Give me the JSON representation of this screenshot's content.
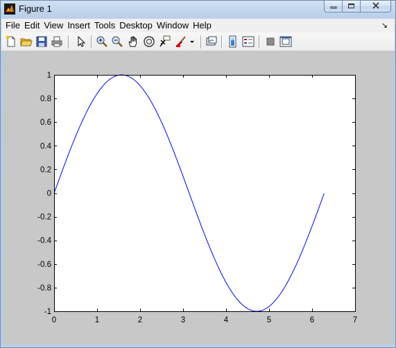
{
  "window": {
    "title": "Figure 1"
  },
  "menu": {
    "items": [
      "File",
      "Edit",
      "View",
      "Insert",
      "Tools",
      "Desktop",
      "Window",
      "Help"
    ],
    "overflow_arrow": "↘"
  },
  "toolbar": {
    "icons": [
      "new-figure-icon",
      "open-file-icon",
      "save-figure-icon",
      "print-figure-icon",
      "edit-plot-arrow-icon",
      "zoom-in-icon",
      "zoom-out-icon",
      "pan-hand-icon",
      "rotate-3d-icon",
      "data-cursor-icon",
      "brush-icon",
      "brush-dropdown-icon",
      "link-plot-icon",
      "insert-colorbar-icon",
      "insert-legend-icon",
      "hide-plot-tools-icon",
      "show-plot-tools-icon"
    ]
  },
  "chart_data": {
    "type": "line",
    "function": "sin(x)",
    "x_start": 0,
    "x_end": 6.28,
    "xlim": [
      0,
      7
    ],
    "ylim": [
      -1,
      1
    ],
    "xticks": [
      "0",
      "1",
      "2",
      "3",
      "4",
      "5",
      "6",
      "7"
    ],
    "yticks": [
      "1",
      "0.8",
      "0.6",
      "0.4",
      "0.2",
      "0",
      "-0.2",
      "-0.4",
      "-0.6",
      "-0.8",
      "-1"
    ],
    "line_color": "#0000ff",
    "grid": false,
    "title": "",
    "xlabel": "",
    "ylabel": ""
  },
  "colors": {
    "figure_background": "#c8c8c8",
    "axes_background": "#ffffff",
    "line": "#0000ff"
  }
}
